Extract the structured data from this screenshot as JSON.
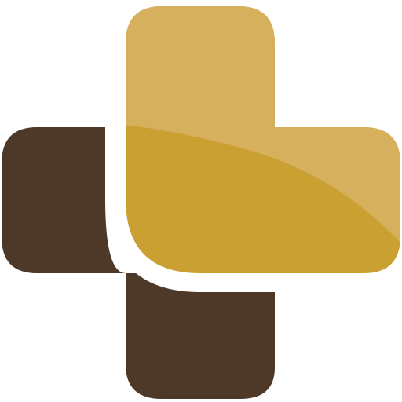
{
  "logo": {
    "name": "medical-cross-logo",
    "colors": {
      "background": "#ffffff",
      "dark_piece": "#4e3828",
      "gold_piece": "#caa032",
      "gold_highlight": "#d7b160",
      "separator": "#ffffff"
    }
  }
}
